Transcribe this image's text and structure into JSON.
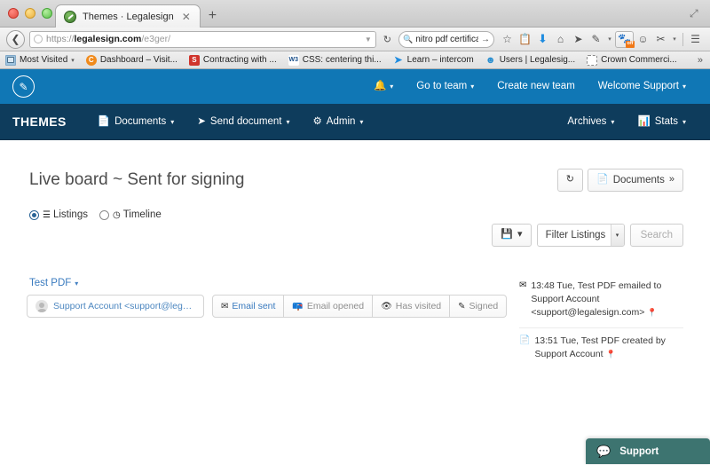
{
  "browser": {
    "tab": {
      "title": "Themes · Legalesign",
      "close_icon": "close-icon",
      "favicon": "legalesign-favicon"
    },
    "new_tab_label": "+",
    "back_icon": "back-arrow-icon",
    "url": {
      "scheme": "https://",
      "host": "legalesign.com",
      "path": "/e3ger/"
    },
    "url_caret": "▼",
    "reload_icon": "↻",
    "search": {
      "value": "nitro pdf certificate",
      "go_icon": "→",
      "mag_icon": "search-icon"
    },
    "toolbar_icons": [
      "star-icon",
      "clipboard-icon",
      "download-icon",
      "home-icon",
      "paper-plane-icon",
      "eyedropper-icon",
      "dropdown-caret-icon",
      "addon-badge-icon",
      "smiley-icon",
      "pin-icon",
      "dropdown-caret-icon",
      "hamburger-menu-icon"
    ],
    "addon_badge_text": "off",
    "bookmarks": [
      {
        "label": "Most Visited",
        "icon": "folder-icon",
        "caret": "▾"
      },
      {
        "label": "Dashboard – Visit...",
        "icon": "orange-circle-icon",
        "caret": ""
      },
      {
        "label": "Contracting with ...",
        "icon": "red-s-icon",
        "caret": ""
      },
      {
        "label": "CSS: centering thi...",
        "icon": "w3c-icon",
        "caret": ""
      },
      {
        "label": "Learn – intercom",
        "icon": "intercom-icon",
        "caret": ""
      },
      {
        "label": "Users | Legalesig...",
        "icon": "users-icon",
        "caret": ""
      },
      {
        "label": "Crown Commerci...",
        "icon": "dashed-box-icon",
        "caret": ""
      }
    ],
    "bookmarks_overflow": "»",
    "fullscreen_icon": "⤢"
  },
  "topnav": {
    "logo_icon": "pen-circle-logo",
    "items": [
      {
        "label": "",
        "icon": "bell-icon",
        "caret": "▾"
      },
      {
        "label": "Go to team",
        "icon": "",
        "caret": "▾"
      },
      {
        "label": "Create new team",
        "icon": "",
        "caret": ""
      },
      {
        "label": "Welcome Support",
        "icon": "",
        "caret": "▾"
      }
    ]
  },
  "mainnav": {
    "brand": "THEMES",
    "items": [
      {
        "label": "Documents",
        "icon": "document-icon",
        "caret": "▾"
      },
      {
        "label": "Send document",
        "icon": "paper-plane-icon",
        "caret": "▾"
      },
      {
        "label": "Admin",
        "icon": "gear-icon",
        "caret": "▾"
      }
    ],
    "right_items": [
      {
        "label": "Archives",
        "icon": "",
        "caret": "▾"
      },
      {
        "label": "Stats",
        "icon": "bar-chart-icon",
        "caret": "▾"
      }
    ]
  },
  "main": {
    "title": "Live board ~ Sent for signing",
    "view_options": [
      {
        "label": "Listings",
        "icon": "list-icon",
        "selected": true
      },
      {
        "label": "Timeline",
        "icon": "clock-icon",
        "selected": false
      }
    ],
    "toolbar": {
      "refresh_icon": "refresh-icon",
      "documents_label": "Documents",
      "documents_icon": "document-icon",
      "documents_caret": "»"
    },
    "filter": {
      "save_icon": "save-icon",
      "save_caret": "▾",
      "select_value": "Filter Listings",
      "select_caret": "▾",
      "search_label": "Search"
    },
    "listing": {
      "doc_name": "Test PDF",
      "doc_caret": "▾",
      "recipient": {
        "name": "Support Account <support@legalesig...",
        "avatar_icon": "avatar-placeholder-icon"
      },
      "statuses": [
        {
          "label": "Email sent",
          "icon": "envelope-icon",
          "active": true
        },
        {
          "label": "Email opened",
          "icon": "open-envelope-icon",
          "active": false
        },
        {
          "label": "Has visited",
          "icon": "eye-icon",
          "active": false
        },
        {
          "label": "Signed",
          "icon": "pen-icon",
          "active": false
        }
      ]
    },
    "feed": [
      {
        "icon": "envelope-icon",
        "text": "13:48 Tue, Test PDF emailed to Support Account <support@legalesign.com>",
        "pin": "location-pin-icon"
      },
      {
        "icon": "document-icon",
        "text": "13:51 Tue, Test PDF created by Support Account",
        "pin": "location-pin-icon"
      }
    ]
  },
  "support_widget": {
    "label": "Support",
    "icon": "chat-bubble-icon",
    "color": "#3d7470"
  }
}
